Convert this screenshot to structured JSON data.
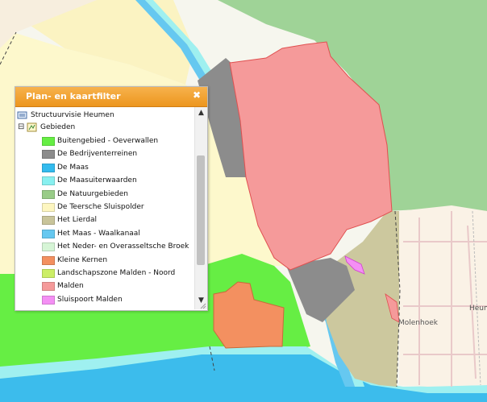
{
  "panel": {
    "title": "Plan- en kaartfilter",
    "close_icon": "✖"
  },
  "tree": {
    "root_label": "Structuurvisie Heumen",
    "group_label": "Gebieden",
    "expand_toggle": "⊟",
    "items": [
      {
        "label": "Buitengebied - Oeverwallen",
        "color": "#66ee44"
      },
      {
        "label": "De Bedrijventerreinen",
        "color": "#8c8c8c"
      },
      {
        "label": "De Maas",
        "color": "#33bbee"
      },
      {
        "label": "De Maasuiterwaarden",
        "color": "#88f0f0"
      },
      {
        "label": "De Natuurgebieden",
        "color": "#99cc88"
      },
      {
        "label": "De Teersche Sluispolder",
        "color": "#fdf6c0"
      },
      {
        "label": "Het Lierdal",
        "color": "#c8c49a"
      },
      {
        "label": "Het Maas - Waalkanaal",
        "color": "#66c8f0"
      },
      {
        "label": "Het Neder- en Overasseltsche Broek",
        "color": "#d6f5d6"
      },
      {
        "label": "Kleine Kernen",
        "color": "#f39060"
      },
      {
        "label": "Landschapszone Malden - Noord",
        "color": "#ccee66"
      },
      {
        "label": "Malden",
        "color": "#f59a9a"
      },
      {
        "label": "Sluispoort Malden",
        "color": "#f48ff4"
      }
    ]
  },
  "scrollbar": {
    "up": "▲",
    "down": "▼"
  },
  "map": {
    "labels": {
      "molenhoek": "Molenhoek",
      "heum": "Heum"
    }
  }
}
